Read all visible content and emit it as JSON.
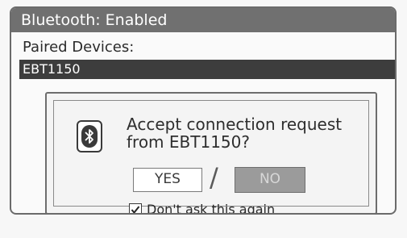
{
  "window": {
    "title": "Bluetooth: Enabled"
  },
  "paired": {
    "label": "Paired Devices:",
    "devices": [
      "EBT1150"
    ]
  },
  "dialog": {
    "icon": "bluetooth-icon",
    "question": "Accept connection request from EBT1150?",
    "yes_label": "YES",
    "separator": "/",
    "no_label": "NO",
    "checkbox_label": "Don't ask this again",
    "checkbox_checked": true
  },
  "colors": {
    "titlebar": "#707070",
    "selected_row": "#3d3d3d",
    "no_button": "#9b9b9b"
  }
}
